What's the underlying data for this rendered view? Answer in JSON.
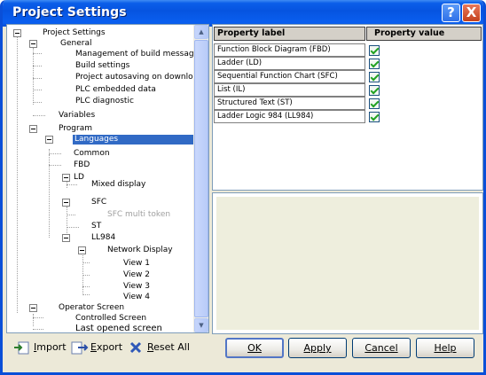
{
  "window": {
    "title": "Project Settings",
    "help_glyph": "?",
    "close_glyph": "X"
  },
  "tree": {
    "root": "Project Settings",
    "general": "General",
    "general_items": [
      "Management of build messages",
      "Build settings",
      "Project autosaving on download",
      "PLC embedded data",
      "PLC diagnostic"
    ],
    "variables": "Variables",
    "program": "Program",
    "languages": "Languages",
    "common": "Common",
    "fbd": "FBD",
    "ld": "LD",
    "mixed_display": "Mixed display",
    "sfc": "SFC",
    "sfc_multi_token": "SFC multi token",
    "st": "ST",
    "ll984": "LL984",
    "network_display": "Network Display",
    "views": [
      "View 1",
      "View 2",
      "View 3",
      "View 4"
    ],
    "operator_screen": "Operator Screen",
    "controlled_screen": "Controlled Screen",
    "last_opened_screen": "Last opened screen"
  },
  "grid": {
    "col_label": "Property label",
    "col_value": "Property value",
    "rows": [
      {
        "label": "Function Block Diagram (FBD)",
        "checked": true
      },
      {
        "label": "Ladder (LD)",
        "checked": true
      },
      {
        "label": "Sequential Function Chart (SFC)",
        "checked": true
      },
      {
        "label": "List (IL)",
        "checked": true
      },
      {
        "label": "Structured Text (ST)",
        "checked": true
      },
      {
        "label": "Ladder Logic 984 (LL984)",
        "checked": true
      }
    ]
  },
  "toolbar": {
    "import_label": "Import",
    "import_key": "I",
    "export_label": "Export",
    "export_key": "E",
    "reset_label": "Reset All",
    "reset_key": "R"
  },
  "buttons": {
    "ok": "OK",
    "apply": "Apply",
    "cancel": "Cancel",
    "help": "Help"
  },
  "colors": {
    "titlebar": "#0654e0",
    "selection": "#316ac5",
    "check": "#21a121"
  }
}
